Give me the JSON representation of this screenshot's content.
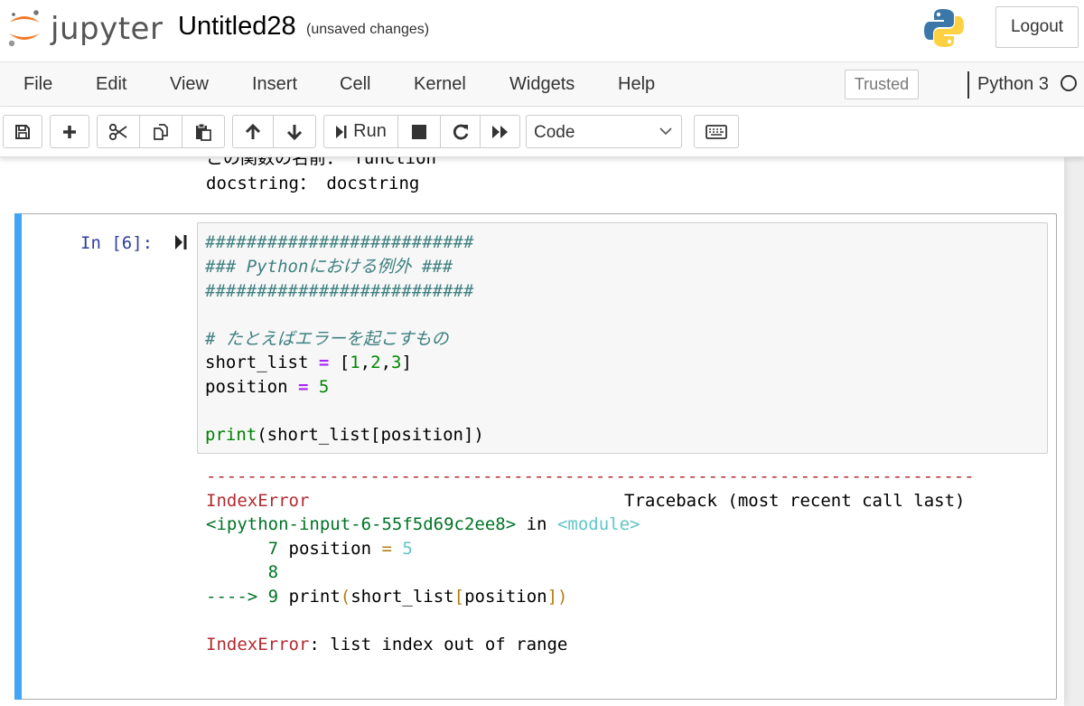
{
  "header": {
    "logo_text": "jupyter",
    "notebook_name": "Untitled28",
    "save_status": "(unsaved changes)",
    "logout_label": "Logout"
  },
  "menubar": {
    "items": [
      "File",
      "Edit",
      "View",
      "Insert",
      "Cell",
      "Kernel",
      "Widgets",
      "Help"
    ],
    "trusted_label": "Trusted",
    "kernel_name": "Python 3"
  },
  "toolbar": {
    "run_label": "Run",
    "cell_type": "Code"
  },
  "previous_output": {
    "line1": "この関数の名前： function",
    "line2": "docstring： docstring"
  },
  "cell": {
    "prompt": "In [6]:",
    "code": {
      "comment1": "##########################",
      "comment2": "### Pythonにおける例外 ###",
      "comment3": "##########################",
      "comment4": "# たとえばエラーを起こすもの",
      "l6_var": "short_list",
      "l6_op": "=",
      "l6_open": "[",
      "l6_n1": "1",
      "l6_c1": ",",
      "l6_n2": "2",
      "l6_c2": ",",
      "l6_n3": "3",
      "l6_close": "]",
      "l7_var": "position",
      "l7_op": "=",
      "l7_num": "5",
      "l9_fn": "print",
      "l9_args": "(short_list[position])"
    },
    "output": {
      "dashes": "---------------------------------------------------------------------------",
      "error_name": "IndexError",
      "traceback_label": "Traceback (most recent call last)",
      "input_ref": "<ipython-input-6-55f5d69c2ee8>",
      "in_word": " in ",
      "module": "<module>",
      "tb1_num": "7",
      "tb1_var": "position",
      "tb1_op": "=",
      "tb1_val": "5",
      "tb2_num": "8",
      "tb3_arrow": "---->",
      "tb3_num": "9",
      "tb3_fn": "print",
      "tb3_p1": "(",
      "tb3_arg": "short_list",
      "tb3_b1": "[",
      "tb3_idx": "position",
      "tb3_b2": "]",
      "tb3_p2": ")",
      "final_error": "IndexError",
      "final_msg": ": list index out of range"
    }
  },
  "colors": {
    "selected_cell_bar": "#42a5f5",
    "prompt": "#303f9f",
    "comment": "#408080",
    "operator": "#aa22ff",
    "number": "#008800",
    "error_red": "#b22b31",
    "traceback_green": "#007427",
    "traceback_cyan": "#60c6c8",
    "traceback_yellow": "#b27d12"
  },
  "icons": [
    "jupyter-logo-icon",
    "python-logo-icon",
    "save-icon",
    "plus-icon",
    "cut-icon",
    "copy-icon",
    "paste-icon",
    "arrow-up-icon",
    "arrow-down-icon",
    "step-run-icon",
    "stop-icon",
    "restart-icon",
    "fast-forward-icon",
    "chevron-down-icon",
    "keyboard-icon",
    "kernel-idle-icon"
  ]
}
